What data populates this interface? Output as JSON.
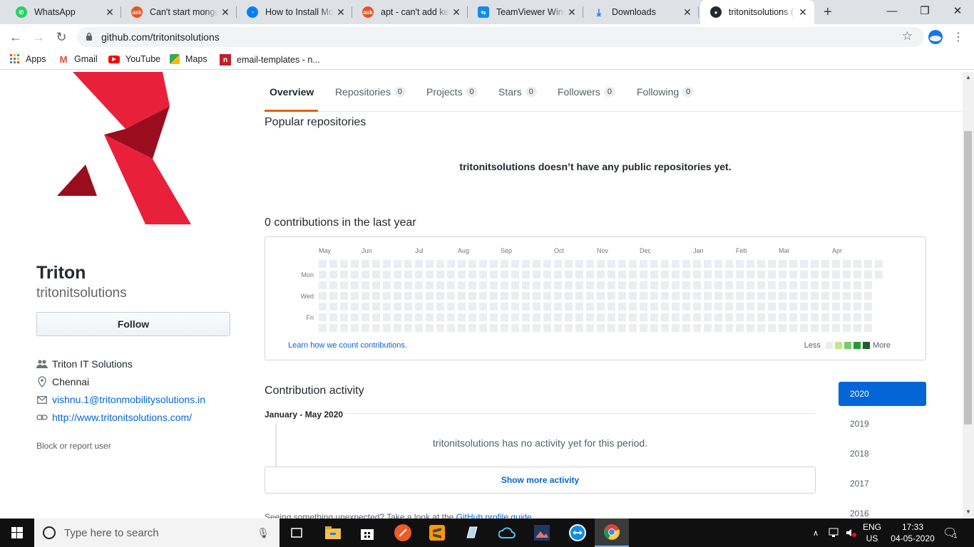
{
  "browser": {
    "tabs": [
      {
        "title": "WhatsApp",
        "icon": "whatsapp-icon",
        "color": "#25d366"
      },
      {
        "title": "Can't start mongodb",
        "icon": "askubuntu-icon",
        "color": "#e95420"
      },
      {
        "title": "How to Install MongoDB",
        "icon": "digitalocean-icon",
        "color": "#0080ff"
      },
      {
        "title": "apt - can't add key",
        "icon": "askubuntu-icon",
        "color": "#e95420"
      },
      {
        "title": "TeamViewer Windows",
        "icon": "teamviewer-icon",
        "color": "#0e8ee9"
      },
      {
        "title": "Downloads",
        "icon": "download-icon",
        "color": "#1a73e8"
      },
      {
        "title": "tritonitsolutions (Triton)",
        "icon": "github-icon",
        "color": "#24292e"
      }
    ],
    "url": "github.com/tritonitsolutions",
    "bookmarks": [
      {
        "label": "Apps",
        "icon": "apps-grid-icon"
      },
      {
        "label": "Gmail",
        "icon": "gmail-icon"
      },
      {
        "label": "YouTube",
        "icon": "youtube-icon"
      },
      {
        "label": "Maps",
        "icon": "maps-icon"
      },
      {
        "label": "email-templates - n...",
        "icon": "bookmark-icon"
      }
    ]
  },
  "profile": {
    "name": "Triton",
    "login": "tritonitsolutions",
    "follow_label": "Follow",
    "org": "Triton IT Solutions",
    "location": "Chennai",
    "email": "vishnu.1@tritonmobilitysolutions.in",
    "website": "http://www.tritonitsolutions.com/",
    "block_label": "Block or report user"
  },
  "nav": {
    "tabs": [
      {
        "label": "Overview",
        "count": null
      },
      {
        "label": "Repositories",
        "count": "0"
      },
      {
        "label": "Projects",
        "count": "0"
      },
      {
        "label": "Stars",
        "count": "0"
      },
      {
        "label": "Followers",
        "count": "0"
      },
      {
        "label": "Following",
        "count": "0"
      }
    ],
    "accent": "#e36209"
  },
  "popular": {
    "title": "Popular repositories",
    "empty": "tritonitsolutions doesn’t have any public repositories yet."
  },
  "contributions": {
    "title": "0 contributions in the last year",
    "months": [
      "May",
      "Jun",
      "Jul",
      "Aug",
      "Sep",
      "Oct",
      "Nov",
      "Dec",
      "Jan",
      "Feb",
      "Mar",
      "Apr"
    ],
    "days": [
      "Mon",
      "Wed",
      "Fri"
    ],
    "learn": "Learn how we count contributions.",
    "less": "Less",
    "more": "More",
    "scale": [
      "#ebedf0",
      "#c6e48b",
      "#7bc96f",
      "#239a3b",
      "#196127"
    ]
  },
  "activity": {
    "title": "Contribution activity",
    "period": "January - May 2020",
    "empty": "tritonitsolutions has no activity yet for this period.",
    "show_more": "Show more activity",
    "footer_text": "Seeing something unexpected? Take a look at the",
    "footer_link": "GitHub profile guide",
    "footer_end": ".",
    "years": [
      "2020",
      "2019",
      "2018",
      "2017",
      "2016"
    ]
  },
  "taskbar": {
    "search_placeholder": "Type here to search",
    "lang1": "ENG",
    "lang2": "US",
    "time": "17:33",
    "date": "04-05-2020",
    "notif_count": "1"
  }
}
